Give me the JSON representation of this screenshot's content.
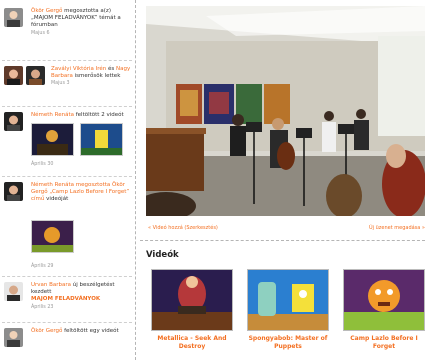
{
  "feed": [
    {
      "name": "Ökör Gergő",
      "text": " megosztotta a(z) „MAJOM FELADVÁNYOK” témát a",
      "sub": "fórumban",
      "time": "Majus 6"
    },
    {
      "name": "Zavályi Viktória Irén",
      "text": " és ",
      "name2": "Nagy Barbara",
      "sub": "ismerősök lettek",
      "time": "Majus 3"
    },
    {
      "name": "Németh Renáta",
      "text": " feltöltött 2 videót",
      "time": "Április 30"
    },
    {
      "name": "Németh Renáta megosztotta Ökör Gergő „Camp Lazlo Before I Forget” című",
      "text": "",
      "sub": "videóját",
      "time": "Április 29"
    },
    {
      "name": "Urvan Barbara",
      "text": " új beszélgetést",
      "sub": "kezdett",
      "link": "MAJOM FELADVÁNYOK",
      "time": "Április 23"
    },
    {
      "name": "Ökör Gergő",
      "text": " feltöltött egy videót",
      "time": ""
    }
  ],
  "player": {
    "left_link": "« Videó hozzá (Szerkesztés)",
    "right_link": "Új üzenet megadása »"
  },
  "videos": {
    "title": "Videók",
    "items": [
      {
        "title": "Metallica - Seek And Destroy"
      },
      {
        "title": "Spongyabob: Master of Puppets"
      },
      {
        "title": "Camp Lazlo Before I Forget"
      }
    ]
  },
  "colors": {
    "accent": "#f36f21"
  }
}
